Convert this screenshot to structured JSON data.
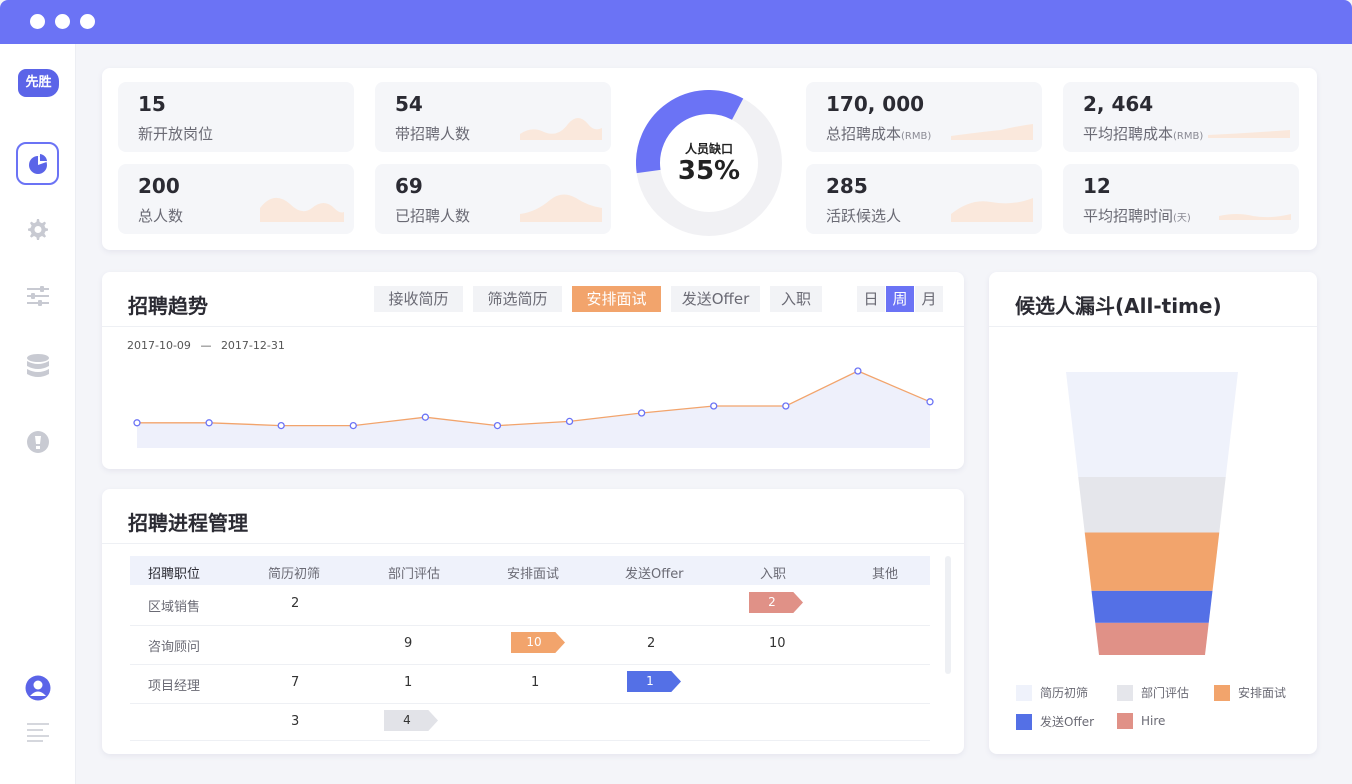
{
  "brand": {
    "logo_text": "先胜"
  },
  "sidebar": {
    "items": [
      {
        "name": "dashboard",
        "icon": "pie-chart-icon",
        "active": true
      },
      {
        "name": "settings",
        "icon": "gear-icon",
        "active": false
      },
      {
        "name": "filters",
        "icon": "sliders-icon",
        "active": false
      },
      {
        "name": "data",
        "icon": "database-icon",
        "active": false
      },
      {
        "name": "info",
        "icon": "bulb-icon",
        "active": false
      }
    ],
    "bottom": [
      {
        "name": "user",
        "icon": "user-avatar-icon"
      },
      {
        "name": "menu",
        "icon": "list-icon"
      }
    ]
  },
  "stats": [
    {
      "value": "15",
      "label": "新开放岗位",
      "unit": ""
    },
    {
      "value": "54",
      "label": "带招聘人数",
      "unit": ""
    },
    {
      "value": "200",
      "label": "总人数",
      "unit": ""
    },
    {
      "value": "69",
      "label": "已招聘人数",
      "unit": ""
    },
    {
      "value": "170, 000",
      "label": "总招聘成本",
      "unit": "(RMB)"
    },
    {
      "value": "2, 464",
      "label": "平均招聘成本",
      "unit": "(RMB)"
    },
    {
      "value": "285",
      "label": "活跃候选人",
      "unit": ""
    },
    {
      "value": "12",
      "label": "平均招聘时间",
      "unit": "(天)"
    }
  ],
  "gap": {
    "label": "人员缺口",
    "value": "35%",
    "fraction": 0.35
  },
  "trend": {
    "title": "招聘趋势",
    "tabs": [
      "接收简历",
      "筛选简历",
      "安排面试",
      "发送Offer",
      "入职"
    ],
    "active_tab": 2,
    "periods": [
      "日",
      "周",
      "月"
    ],
    "active_period": 1,
    "range_start": "2017-10-09",
    "range_sep": "—",
    "range_end": "2017-12-31"
  },
  "chart_data": {
    "type": "area",
    "values": [
      18,
      18,
      16,
      16,
      22,
      16,
      19,
      25,
      30,
      30,
      55,
      33
    ],
    "ylim": [
      0,
      70
    ],
    "line_color": "#f2a46c",
    "fill_color": "#eef0fb",
    "marker_color": "#6b73f5"
  },
  "process": {
    "title": "招聘进程管理",
    "columns": [
      "招聘职位",
      "简历初筛",
      "部门评估",
      "安排面试",
      "发送Offer",
      "入职",
      "其他"
    ],
    "rows": [
      {
        "name": "区域销售",
        "cells": [
          "2",
          "",
          "",
          "",
          {
            "v": "2",
            "style": "salmon"
          },
          ""
        ]
      },
      {
        "name": "咨询顾问",
        "cells": [
          "",
          "9",
          {
            "v": "10",
            "style": "orange"
          },
          "2",
          "10",
          ""
        ]
      },
      {
        "name": "项目经理",
        "cells": [
          "7",
          "1",
          "1",
          {
            "v": "1",
            "style": "blue"
          },
          "",
          ""
        ]
      },
      {
        "name": "",
        "cells": [
          "3",
          {
            "v": "4",
            "style": "grey"
          },
          "",
          "",
          "",
          ""
        ]
      }
    ]
  },
  "funnel": {
    "title": "候选人漏斗(All-time)",
    "stages": [
      {
        "label": "简历初筛",
        "color": "#eff2fb",
        "share": 0.36
      },
      {
        "label": "部门评估",
        "color": "#e5e6eb",
        "share": 0.19
      },
      {
        "label": "安排面试",
        "color": "#f2a46c",
        "share": 0.2
      },
      {
        "label": "发送Offer",
        "color": "#5470e6",
        "share": 0.11
      },
      {
        "label": "Hire",
        "color": "#e09187",
        "share": 0.11
      }
    ]
  }
}
